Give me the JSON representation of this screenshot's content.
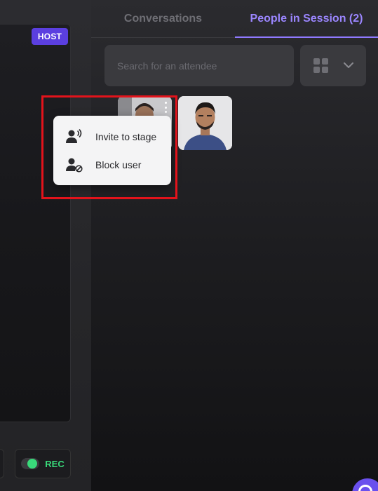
{
  "stage": {
    "host_badge": "HOST",
    "rec_label": "REC",
    "rec_on": true
  },
  "tabs": {
    "conversations": "Conversations",
    "people": "People in Session (2)",
    "active": "people"
  },
  "search": {
    "placeholder": "Search for an attendee",
    "value": ""
  },
  "view_toggle": {
    "icon": "grid-icon",
    "dropdown_icon": "chevron-down-icon"
  },
  "attendees": [
    {
      "icon": "avatar-photo"
    },
    {
      "icon": "avatar-photo"
    }
  ],
  "context_menu": {
    "items": [
      {
        "label": "Invite to stage",
        "icon": "invite-to-stage-icon"
      },
      {
        "label": "Block user",
        "icon": "block-user-icon"
      }
    ]
  },
  "colors": {
    "accent": "#9b86ff",
    "host_badge": "#5b3fe0",
    "rec_green": "#39d97a",
    "highlight": "#e3131b"
  }
}
